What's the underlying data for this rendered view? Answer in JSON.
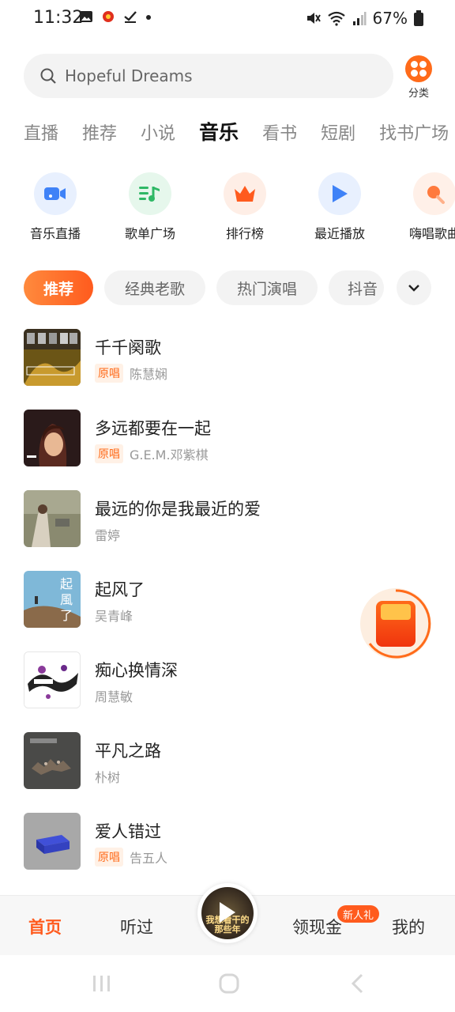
{
  "status_bar": {
    "time": "11:32",
    "battery": "67%"
  },
  "search": {
    "placeholder": "Hopeful Dreams",
    "category_label": "分类"
  },
  "tabs": [
    {
      "label": "直播",
      "active": false
    },
    {
      "label": "推荐",
      "active": false
    },
    {
      "label": "小说",
      "active": false
    },
    {
      "label": "音乐",
      "active": true
    },
    {
      "label": "看书",
      "active": false
    },
    {
      "label": "短剧",
      "active": false
    },
    {
      "label": "找书广场",
      "active": false
    }
  ],
  "shortcuts": [
    {
      "label": "音乐直播",
      "icon": "video-camera-icon"
    },
    {
      "label": "歌单广场",
      "icon": "playlist-music-icon"
    },
    {
      "label": "排行榜",
      "icon": "crown-icon"
    },
    {
      "label": "最近播放",
      "icon": "play-icon"
    },
    {
      "label": "嗨唱歌曲",
      "icon": "microphone-icon"
    }
  ],
  "chips": [
    {
      "label": "推荐",
      "active": true
    },
    {
      "label": "经典老歌",
      "active": false
    },
    {
      "label": "热门演唱",
      "active": false
    },
    {
      "label": "抖音",
      "active": false
    }
  ],
  "songs": [
    {
      "title": "千千阕歌",
      "tag": "原唱",
      "artist": "陈慧娴"
    },
    {
      "title": "多远都要在一起",
      "tag": "原唱",
      "artist": "G.E.M.邓紫棋"
    },
    {
      "title": "最远的你是我最近的爱",
      "tag": "",
      "artist": "雷婷"
    },
    {
      "title": "起风了",
      "tag": "",
      "artist": "吴青峰"
    },
    {
      "title": "痴心换情深",
      "tag": "",
      "artist": "周慧敏"
    },
    {
      "title": "平凡之路",
      "tag": "",
      "artist": "朴树"
    },
    {
      "title": "爱人错过",
      "tag": "原唱",
      "artist": "告五人"
    }
  ],
  "bottom_nav": {
    "home": "首页",
    "listened": "听过",
    "now_playing_text": "我想看干的那些年",
    "cash": "领现金",
    "cash_badge": "新人礼",
    "mine": "我的"
  },
  "colors": {
    "accent": "#ff5b1e",
    "accent_light": "#ff8a3d",
    "tag_bg": "#fff1e6"
  }
}
